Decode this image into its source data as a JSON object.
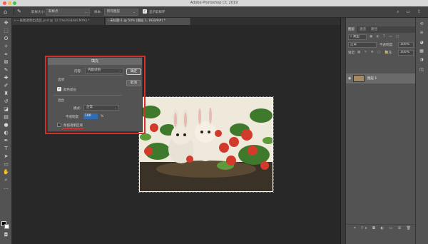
{
  "window": {
    "title": "Adobe Photoshop CC 2019"
  },
  "options_bar": {
    "size_label": "取样大小:",
    "size_value": "取样点",
    "sample_label": "样本:",
    "sample_value": "所有图层",
    "show_ring_label": "显示取样环"
  },
  "tabs": [
    {
      "label": "一张图透明出选区.psd @ 12.5%(RGB/8/CMYK) *",
      "active": false
    },
    {
      "label": "未标题-1 @ 50% (图层 1, RGB/8#) *",
      "active": true
    }
  ],
  "dialog": {
    "title": "填充",
    "content_label": "内容:",
    "content_value": "内容识别",
    "options_label": "选项",
    "color_adapt_label": "颜色适应",
    "blend_label": "混合",
    "mode_label": "模式:",
    "mode_value": "正常",
    "opacity_label": "不透明度:",
    "opacity_value": "100",
    "opacity_unit": "%",
    "preserve_label": "保留透明区域",
    "ok_label": "确定",
    "cancel_label": "取消"
  },
  "layers_panel": {
    "tab_layers": "图层",
    "tab_channels": "通道",
    "tab_paths": "路径",
    "kind_filter": "类型",
    "blend_mode": "正常",
    "opacity_label": "不透明度:",
    "opacity_value": "100%",
    "lock_label": "锁定:",
    "fill_label": "填充:",
    "fill_value": "100%",
    "layer_name": "图层 1"
  },
  "colors": {
    "highlight_red": "#d3302c",
    "selected_blue": "#2f6db5"
  }
}
